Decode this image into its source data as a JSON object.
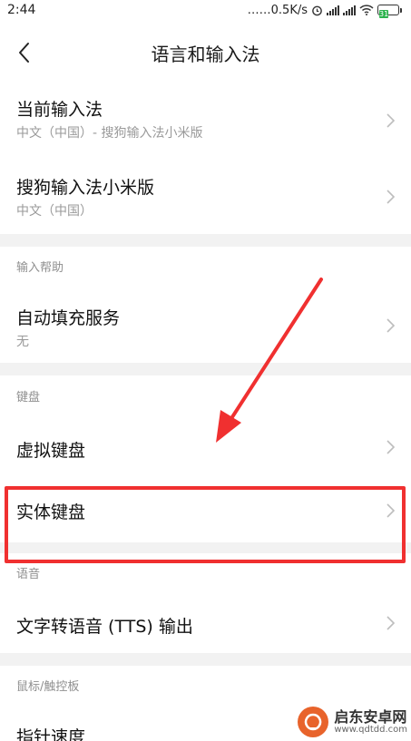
{
  "status": {
    "time": "2:44",
    "speed": "……0.5K/s",
    "battery": "31",
    "icons": [
      "alarm-icon",
      "cell-signal-icon",
      "cell-signal-icon",
      "wifi-icon",
      "battery-icon"
    ]
  },
  "header": {
    "back_icon": "chevron-left-icon",
    "title": "语言和输入法"
  },
  "items": {
    "current_ime": {
      "title": "当前输入法",
      "subtitle": "中文（中国）- 搜狗输入法小米版"
    },
    "sogou": {
      "title": "搜狗输入法小米版",
      "subtitle": "中文（中国）"
    },
    "autofill": {
      "title": "自动填充服务",
      "subtitle": "无"
    },
    "virtual_kb": {
      "title": "虚拟键盘"
    },
    "physical_kb": {
      "title": "实体键盘"
    },
    "tts": {
      "title": "文字转语音 (TTS) 输出"
    },
    "pointer": {
      "title": "指针速度"
    }
  },
  "sections": {
    "input_help": "输入帮助",
    "keyboard": "键盘",
    "speech": "语音",
    "mouse": "鼠标/触控板"
  },
  "watermark": {
    "name": "启东安卓网",
    "url": "www.qdtdd.com"
  },
  "colors": {
    "annotation": "#f03030",
    "battery": "#2bb24c"
  }
}
